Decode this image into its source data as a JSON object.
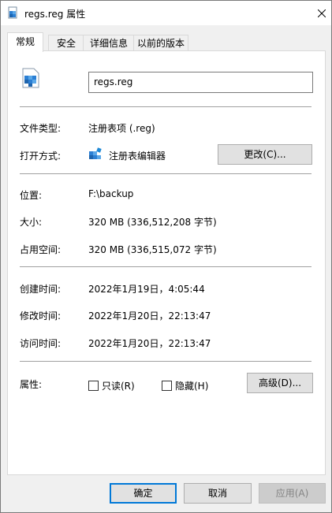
{
  "window": {
    "title": "regs.reg 属性"
  },
  "tabs": [
    {
      "label": "常规"
    },
    {
      "label": "安全"
    },
    {
      "label": "详细信息"
    },
    {
      "label": "以前的版本"
    }
  ],
  "general": {
    "filename": "regs.reg",
    "file_type": {
      "label": "文件类型:",
      "value": "注册表项 (.reg)"
    },
    "opens_with": {
      "label": "打开方式:",
      "value": "注册表编辑器",
      "change_button": "更改(C)..."
    },
    "location": {
      "label": "位置:",
      "value": "F:\\backup"
    },
    "size": {
      "label": "大小:",
      "value": "320 MB (336,512,208 字节)"
    },
    "size_on_disk": {
      "label": "占用空间:",
      "value": "320 MB (336,515,072 字节)"
    },
    "created": {
      "label": "创建时间:",
      "value": "2022年1月19日，4:05:44"
    },
    "modified": {
      "label": "修改时间:",
      "value": "2022年1月20日，22:13:47"
    },
    "accessed": {
      "label": "访问时间:",
      "value": "2022年1月20日，22:13:47"
    },
    "attributes": {
      "label": "属性:",
      "readonly": {
        "label": "只读(R)",
        "checked": false
      },
      "hidden": {
        "label": "隐藏(H)",
        "checked": false
      },
      "advanced_button": "高级(D)..."
    }
  },
  "footer": {
    "ok": "确定",
    "cancel": "取消",
    "apply": "应用(A)"
  },
  "icons": {
    "title": "registry-file-icon",
    "file": "registry-file-icon",
    "app": "regedit-icon",
    "close": "close-icon"
  },
  "colors": {
    "accent": "#0078d7",
    "icon_blue": "#1e88d6"
  }
}
